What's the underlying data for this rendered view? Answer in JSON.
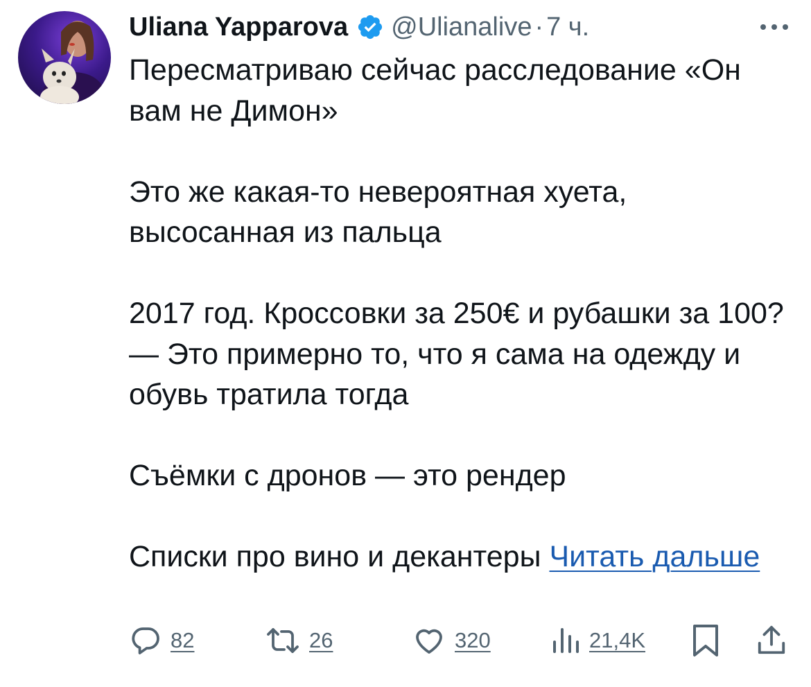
{
  "tweet": {
    "author": {
      "name": "Uliana Yapparova",
      "handle": "@Ulianalive",
      "separator": "·",
      "time": "7 ч.",
      "verified": true,
      "avatar_icon": "profile-photo-with-dog"
    },
    "more_icon": "more-dots-icon",
    "paragraphs": [
      "Пересматриваю сейчас расследование «Он вам не Димон»",
      "Это же какая-то невероятная хуета, высосанная из пальца",
      "2017 год. Кроссовки за 250€ и рубашки за 100? — Это примерно то, что я сама на одежду и обувь тратила тогда",
      "Съёмки с дронов — это рендер"
    ],
    "last_paragraph": "Списки про вино и декантеры",
    "read_more": "Читать дальше",
    "actions": {
      "reply": {
        "count": "82",
        "icon": "reply-icon"
      },
      "retweet": {
        "count": "26",
        "icon": "retweet-icon"
      },
      "like": {
        "count": "320",
        "icon": "heart-icon"
      },
      "views": {
        "count": "21,4K",
        "icon": "views-icon"
      },
      "bookmark": {
        "icon": "bookmark-icon"
      },
      "share": {
        "icon": "share-icon"
      }
    },
    "colors": {
      "text": "#0f1419",
      "secondary": "#536471",
      "link": "#1a5bb0",
      "verified": "#1d9bf0"
    }
  }
}
